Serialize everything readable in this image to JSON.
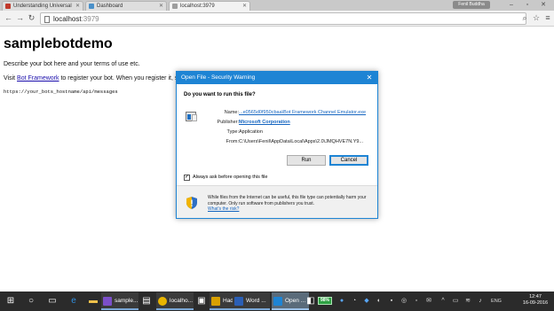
{
  "browser": {
    "tabs": [
      {
        "label": "Understanding Universal",
        "color": "#c0392b"
      },
      {
        "label": "Dashboard",
        "color": "#4a90c9"
      },
      {
        "label": "localhost:3979",
        "color": "#9e9e9e"
      }
    ],
    "profile": "Fenil Buddha",
    "address": {
      "host": "localhost",
      "port": ":3979"
    }
  },
  "page": {
    "title": "samplebotdemo",
    "description": "Describe your bot here and your terms of use etc.",
    "visit_prefix": "Visit ",
    "visit_link": "Bot Framework",
    "visit_suffix": " to register your bot. When you register it, s",
    "endpoint": "https://your_bots_hostname/api/messages"
  },
  "dialog": {
    "title": "Open File - Security Warning",
    "close": "✕",
    "question": "Do you want to run this file?",
    "fields": {
      "name_label": "Name:",
      "name_value": "...e0565d0f950cbaa\\Bot Framework Channel Emulator.exe",
      "publisher_label": "Publisher:",
      "publisher_value": "Microsoft Corporation",
      "type_label": "Type:",
      "type_value": "Application",
      "from_label": "From:",
      "from_value": "C:\\Users\\Fenil\\AppData\\Local\\Apps\\2.0\\JMQHVE7N.Y9..."
    },
    "run_label": "Run",
    "cancel_label": "Cancel",
    "checkbox_label": "Always ask before opening this file",
    "checkbox_checked": true,
    "warning_text": "While files from the Internet can be useful, this file type can potentially harm your computer. Only run software from publishers you trust.",
    "risk_link": "What's the risk?"
  },
  "taskbar": {
    "apps": [
      {
        "label": "sample...",
        "color": "#7b4fc9"
      },
      {
        "label": "localho...",
        "color": "#e8b400"
      },
      {
        "label": "Hadoop",
        "color": "#d8a000"
      },
      {
        "label": "Word ...",
        "color": "#2b5fb5"
      },
      {
        "label": "Open ...",
        "color": "#1e84d4"
      }
    ],
    "battery": "98%",
    "lang": "ENG",
    "time": "12:47",
    "date": "16-09-2016"
  }
}
